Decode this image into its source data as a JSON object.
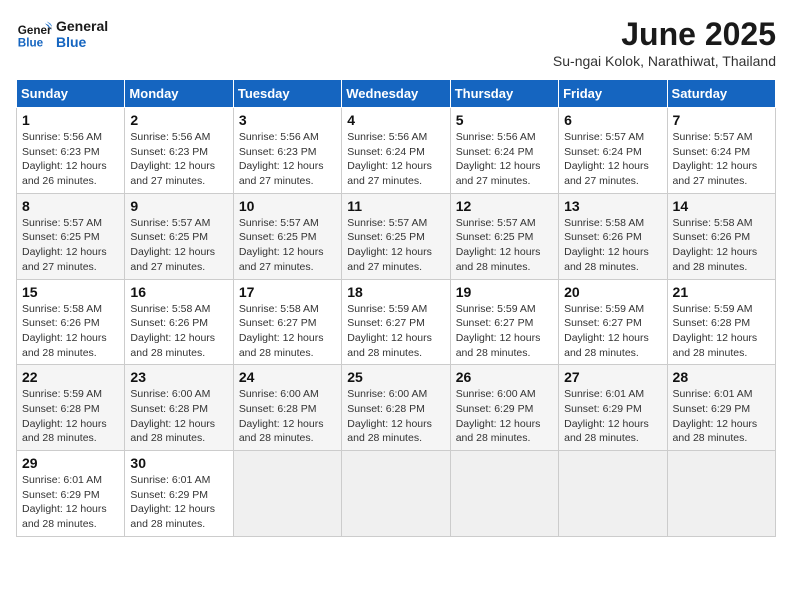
{
  "header": {
    "logo_line1": "General",
    "logo_line2": "Blue",
    "title": "June 2025",
    "subtitle": "Su-ngai Kolok, Narathiwat, Thailand"
  },
  "weekdays": [
    "Sunday",
    "Monday",
    "Tuesday",
    "Wednesday",
    "Thursday",
    "Friday",
    "Saturday"
  ],
  "weeks": [
    [
      {
        "day": "1",
        "info": "Sunrise: 5:56 AM\nSunset: 6:23 PM\nDaylight: 12 hours and 26 minutes."
      },
      {
        "day": "2",
        "info": "Sunrise: 5:56 AM\nSunset: 6:23 PM\nDaylight: 12 hours and 27 minutes."
      },
      {
        "day": "3",
        "info": "Sunrise: 5:56 AM\nSunset: 6:23 PM\nDaylight: 12 hours and 27 minutes."
      },
      {
        "day": "4",
        "info": "Sunrise: 5:56 AM\nSunset: 6:24 PM\nDaylight: 12 hours and 27 minutes."
      },
      {
        "day": "5",
        "info": "Sunrise: 5:56 AM\nSunset: 6:24 PM\nDaylight: 12 hours and 27 minutes."
      },
      {
        "day": "6",
        "info": "Sunrise: 5:57 AM\nSunset: 6:24 PM\nDaylight: 12 hours and 27 minutes."
      },
      {
        "day": "7",
        "info": "Sunrise: 5:57 AM\nSunset: 6:24 PM\nDaylight: 12 hours and 27 minutes."
      }
    ],
    [
      {
        "day": "8",
        "info": "Sunrise: 5:57 AM\nSunset: 6:25 PM\nDaylight: 12 hours and 27 minutes."
      },
      {
        "day": "9",
        "info": "Sunrise: 5:57 AM\nSunset: 6:25 PM\nDaylight: 12 hours and 27 minutes."
      },
      {
        "day": "10",
        "info": "Sunrise: 5:57 AM\nSunset: 6:25 PM\nDaylight: 12 hours and 27 minutes."
      },
      {
        "day": "11",
        "info": "Sunrise: 5:57 AM\nSunset: 6:25 PM\nDaylight: 12 hours and 27 minutes."
      },
      {
        "day": "12",
        "info": "Sunrise: 5:57 AM\nSunset: 6:25 PM\nDaylight: 12 hours and 28 minutes."
      },
      {
        "day": "13",
        "info": "Sunrise: 5:58 AM\nSunset: 6:26 PM\nDaylight: 12 hours and 28 minutes."
      },
      {
        "day": "14",
        "info": "Sunrise: 5:58 AM\nSunset: 6:26 PM\nDaylight: 12 hours and 28 minutes."
      }
    ],
    [
      {
        "day": "15",
        "info": "Sunrise: 5:58 AM\nSunset: 6:26 PM\nDaylight: 12 hours and 28 minutes."
      },
      {
        "day": "16",
        "info": "Sunrise: 5:58 AM\nSunset: 6:26 PM\nDaylight: 12 hours and 28 minutes."
      },
      {
        "day": "17",
        "info": "Sunrise: 5:58 AM\nSunset: 6:27 PM\nDaylight: 12 hours and 28 minutes."
      },
      {
        "day": "18",
        "info": "Sunrise: 5:59 AM\nSunset: 6:27 PM\nDaylight: 12 hours and 28 minutes."
      },
      {
        "day": "19",
        "info": "Sunrise: 5:59 AM\nSunset: 6:27 PM\nDaylight: 12 hours and 28 minutes."
      },
      {
        "day": "20",
        "info": "Sunrise: 5:59 AM\nSunset: 6:27 PM\nDaylight: 12 hours and 28 minutes."
      },
      {
        "day": "21",
        "info": "Sunrise: 5:59 AM\nSunset: 6:28 PM\nDaylight: 12 hours and 28 minutes."
      }
    ],
    [
      {
        "day": "22",
        "info": "Sunrise: 5:59 AM\nSunset: 6:28 PM\nDaylight: 12 hours and 28 minutes."
      },
      {
        "day": "23",
        "info": "Sunrise: 6:00 AM\nSunset: 6:28 PM\nDaylight: 12 hours and 28 minutes."
      },
      {
        "day": "24",
        "info": "Sunrise: 6:00 AM\nSunset: 6:28 PM\nDaylight: 12 hours and 28 minutes."
      },
      {
        "day": "25",
        "info": "Sunrise: 6:00 AM\nSunset: 6:28 PM\nDaylight: 12 hours and 28 minutes."
      },
      {
        "day": "26",
        "info": "Sunrise: 6:00 AM\nSunset: 6:29 PM\nDaylight: 12 hours and 28 minutes."
      },
      {
        "day": "27",
        "info": "Sunrise: 6:01 AM\nSunset: 6:29 PM\nDaylight: 12 hours and 28 minutes."
      },
      {
        "day": "28",
        "info": "Sunrise: 6:01 AM\nSunset: 6:29 PM\nDaylight: 12 hours and 28 minutes."
      }
    ],
    [
      {
        "day": "29",
        "info": "Sunrise: 6:01 AM\nSunset: 6:29 PM\nDaylight: 12 hours and 28 minutes."
      },
      {
        "day": "30",
        "info": "Sunrise: 6:01 AM\nSunset: 6:29 PM\nDaylight: 12 hours and 28 minutes."
      },
      null,
      null,
      null,
      null,
      null
    ]
  ]
}
